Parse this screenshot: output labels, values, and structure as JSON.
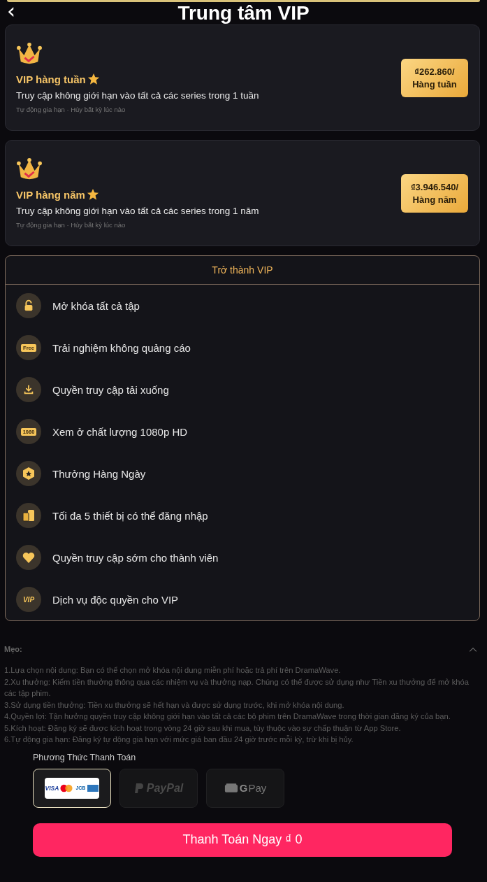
{
  "header": {
    "back": "‹",
    "title": "Trung tâm VIP"
  },
  "plans": [
    {
      "title": "VIP hàng tuần",
      "description": "Truy cập không giới hạn vào tất cả các series trong 1 tuần",
      "note": "Tự động gia hạn · Hủy bất kỳ lúc nào",
      "price": "₫262.860/",
      "period": "Hàng tuần"
    },
    {
      "title": "VIP hàng năm",
      "description": "Truy cập không giới hạn vào tất cả các series trong 1 năm",
      "note": "Tự động gia hạn · Hủy bất kỳ lúc nào",
      "price": "₫3.946.540/",
      "period": "Hàng năm"
    }
  ],
  "benefits": {
    "title": "Trở thành VIP",
    "items": [
      {
        "kind": "lock",
        "label": "Mở khóa tất cả tập"
      },
      {
        "kind": "tag",
        "icon_text": "Free",
        "label": "Trải nghiệm không quảng cáo"
      },
      {
        "kind": "download",
        "label": "Quyền truy cập tải xuống"
      },
      {
        "kind": "tag",
        "icon_text": "1080",
        "label": "Xem ở chất lượng 1080p HD"
      },
      {
        "kind": "reward",
        "label": "Thưởng Hàng Ngày"
      },
      {
        "kind": "devices",
        "label": "Tối đa 5 thiết bị có thể đăng nhập"
      },
      {
        "kind": "heart",
        "label": "Quyền truy cập sớm cho thành viên"
      },
      {
        "kind": "vip",
        "icon_text": "VIP",
        "label": "Dịch vụ độc quyền cho VIP"
      }
    ]
  },
  "tips": {
    "title": "Mẹo:",
    "expanded": true,
    "lines": [
      "1.Lựa chọn nội dung: Bạn có thể chọn mở khóa nội dung miễn phí hoặc trả phí trên DramaWave.",
      "2.Xu thưởng: Kiếm tiền thưởng thông qua các nhiệm vụ và thưởng nạp. Chúng có thể được sử dụng như Tiền xu thưởng để mở khóa các tập phim.",
      "3.Sử dụng tiền thưởng: Tiền xu thưởng sẽ hết hạn và được sử dụng trước, khi mở khóa nội dung.",
      "4.Quyền lợi: Tận hưởng quyền truy cập không giới hạn vào tất cả các bộ phim trên DramaWave trong thời gian đăng ký của bạn.",
      "5.Kích hoạt: Đăng ký sẽ được kích hoạt trong vòng 24 giờ sau khi mua, tùy thuộc vào sự chấp thuận từ App Store.",
      "6.Tự động gia hạn: Đăng ký tự động gia hạn với mức giá ban đầu 24 giờ trước mỗi kỳ, trừ khi bị hủy."
    ]
  },
  "payment": {
    "title": "Phương Thức Thanh Toán",
    "methods": [
      {
        "kind": "card",
        "selected": true,
        "labels": [
          "VISA",
          "JCB"
        ]
      },
      {
        "kind": "paypal",
        "selected": false,
        "labels": [
          "PayPal"
        ]
      },
      {
        "kind": "gpay",
        "selected": false,
        "labels": [
          "G",
          "Pay"
        ]
      }
    ],
    "button": "Thanh Toán Ngay ₫ 0"
  }
}
